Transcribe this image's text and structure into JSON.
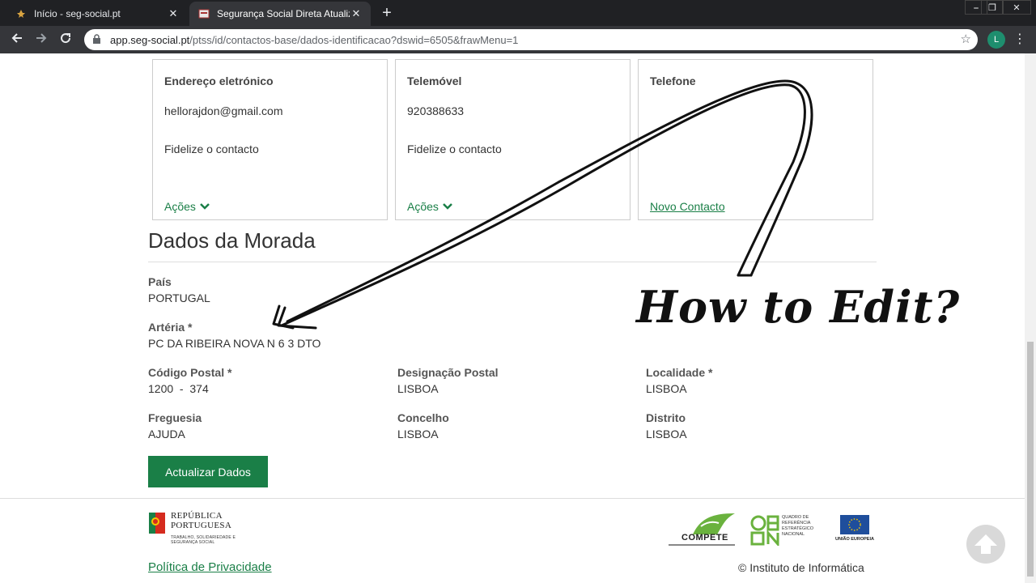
{
  "browser": {
    "tabs": [
      {
        "title": "Início - seg-social.pt",
        "close": "✕"
      },
      {
        "title": "Segurança Social Direta Atualiza",
        "close": "✕"
      }
    ],
    "new_tab": "+",
    "url_host": "app.seg-social.pt",
    "url_path": "/ptss/id/contactos-base/dados-identificacao?dswid=6505&frawMenu=1",
    "profile_initial": "L",
    "window_controls": [
      "⎯",
      "❐",
      "✕"
    ]
  },
  "contacts": [
    {
      "title": "Endereço eletrónico",
      "value": "hellorajdon@gmail.com",
      "fidelize": "Fidelize o contacto",
      "action": "Ações"
    },
    {
      "title": "Telemóvel",
      "value": "920388633",
      "fidelize": "Fidelize o contacto",
      "action": "Ações"
    },
    {
      "title": "Telefone",
      "link": "Novo Contacto"
    }
  ],
  "address": {
    "title": "Dados da Morada",
    "fields": {
      "pais": {
        "label": "País",
        "value": "PORTUGAL"
      },
      "arteria": {
        "label": "Artéria  *",
        "value": "PC DA RIBEIRA NOVA N 6 3 DTO"
      },
      "codigo_postal": {
        "label": "Código Postal  *",
        "value": "1200  -  374"
      },
      "designacao_postal": {
        "label": "Designação Postal",
        "value": "LISBOA"
      },
      "localidade": {
        "label": "Localidade  *",
        "value": "LISBOA"
      },
      "freguesia": {
        "label": "Freguesia",
        "value": "AJUDA"
      },
      "concelho": {
        "label": "Concelho",
        "value": "LISBOA"
      },
      "distrito": {
        "label": "Distrito",
        "value": "LISBOA"
      }
    },
    "update_button": "Actualizar Dados"
  },
  "footer": {
    "republica": "REPÚBLICA PORTUGUESA",
    "ministry": "TRABALHO, SOLIDARIEDADE E SEGURANÇA SOCIAL",
    "privacy": "Política de Privacidade",
    "copyright": "© Instituto de Informática",
    "compete": "COMPETE",
    "qren": "QUADRO DE REFERÊNCIA ESTRATÉGICO NACIONAL",
    "ue": "UNIÃO EUROPEIA"
  },
  "annotation": {
    "text": "How to Edit?"
  },
  "colors": {
    "brand_green": "#1a7f47",
    "chrome_dark": "#202124"
  }
}
